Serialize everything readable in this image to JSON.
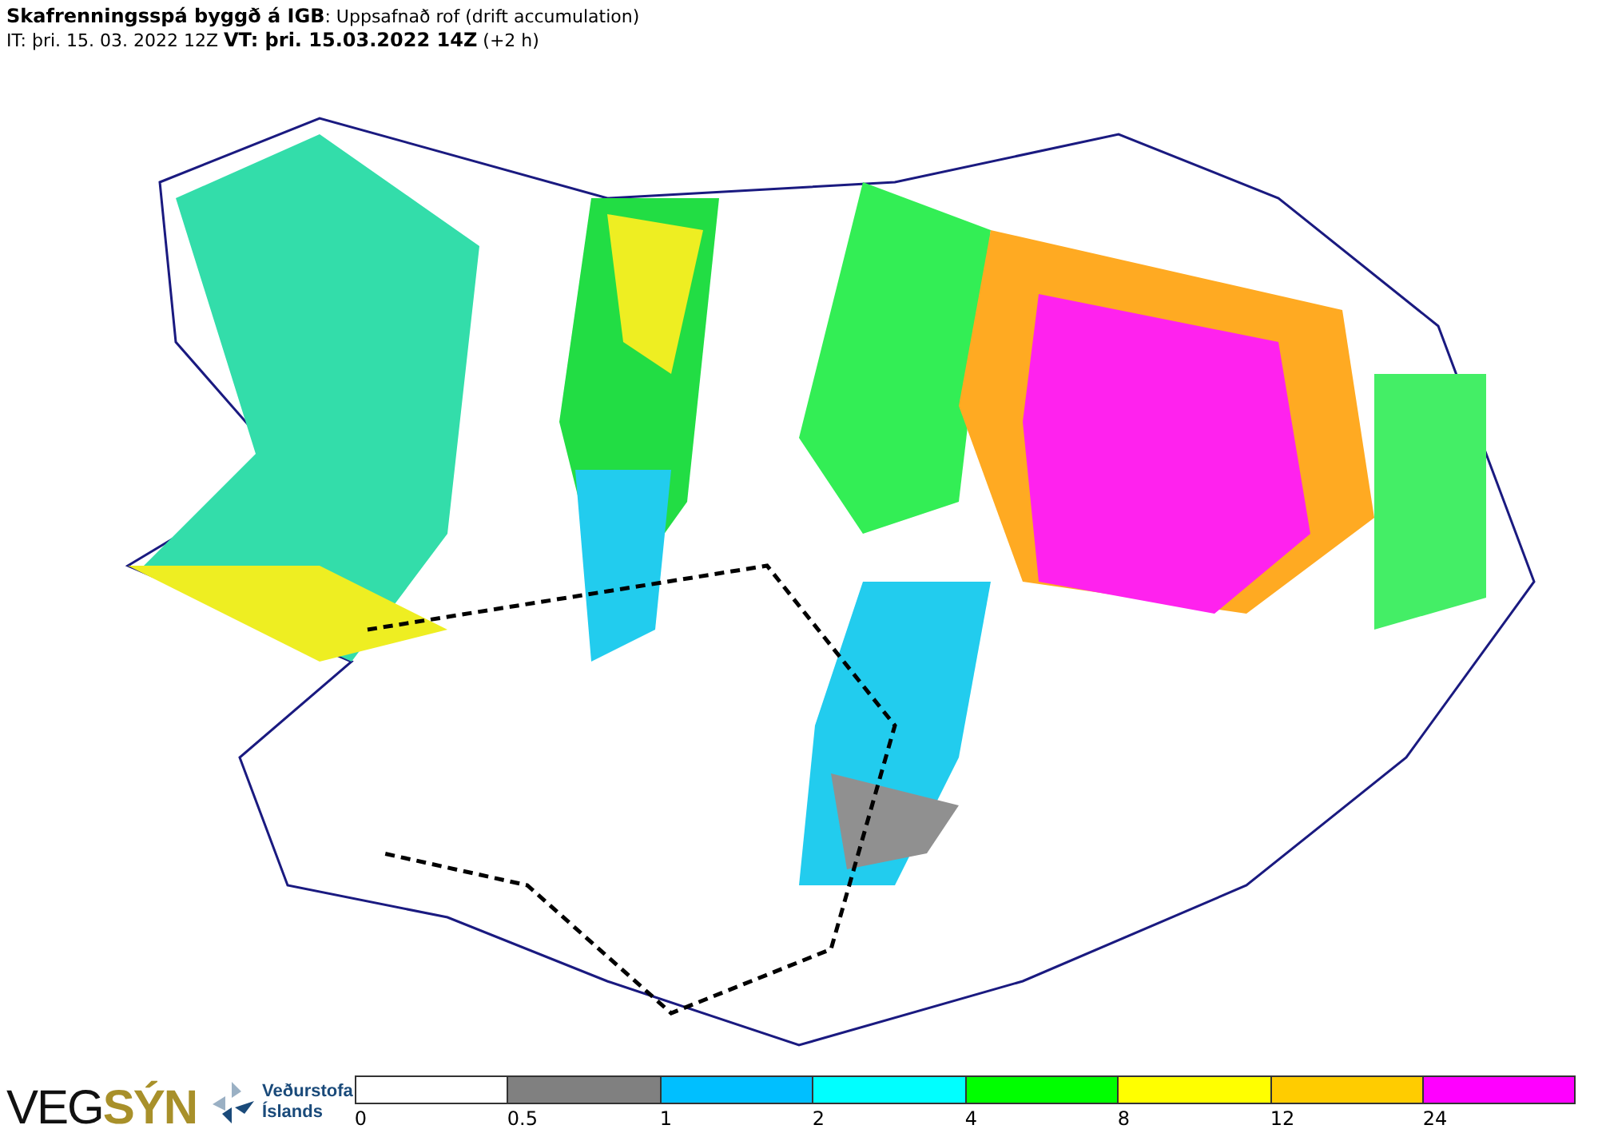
{
  "header": {
    "title": "**Skafrenningsspá byggð á IGB**: Uppsafnað rof (drift accumulation)",
    "times": "IT: þri. 15. 03. 2022 12Z **VT: þri. 15.03.2022 14Z** (+2 h)"
  },
  "logos": {
    "vegsyn": {
      "dark": "VEG",
      "accent": "SÝN"
    },
    "vedurstofa": [
      "Veðurstofa",
      "Íslands"
    ]
  },
  "legend": [
    {
      "label": "0",
      "color": "#ffffff"
    },
    {
      "label": "0.5",
      "color": "#808080"
    },
    {
      "label": "1",
      "color": "#00bfff"
    },
    {
      "label": "2",
      "color": "#00ffff"
    },
    {
      "label": "4",
      "color": "#00ff00"
    },
    {
      "label": "8",
      "color": "#ffff00"
    },
    {
      "label": "12",
      "color": "#ffcc00"
    },
    {
      "label": "24",
      "color": "#ff00ff"
    }
  ]
}
